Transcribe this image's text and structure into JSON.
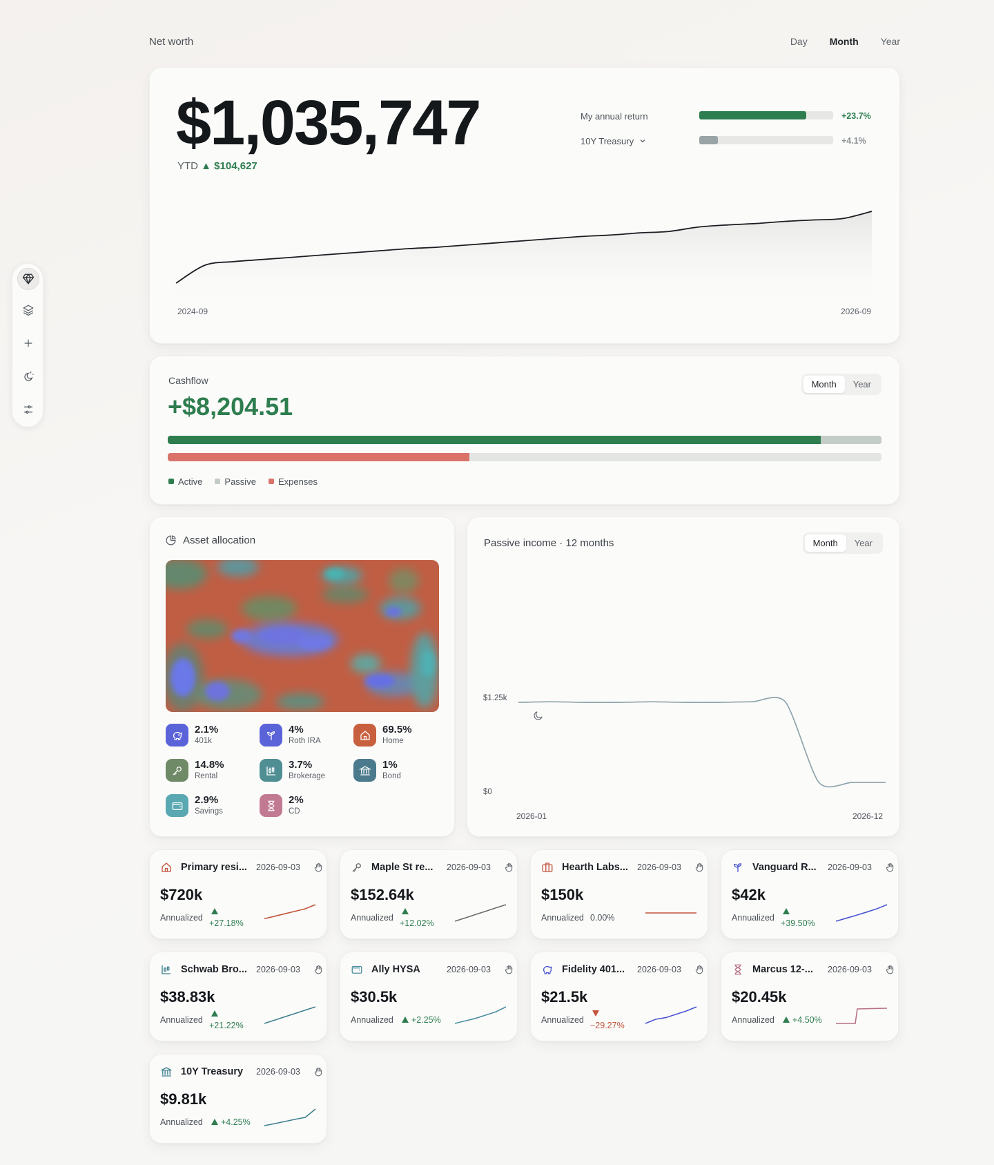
{
  "header": {
    "title": "Net worth",
    "periods": [
      "Day",
      "Month",
      "Year"
    ],
    "active_period": "Month"
  },
  "net_worth": {
    "value": "$1,035,747",
    "ytd_label": "YTD",
    "ytd_change": "▲ $104,627",
    "compare": [
      {
        "label": "My annual return",
        "value": "+23.7%",
        "fill": 0.8,
        "color": "#2e7d4f"
      },
      {
        "label": "10Y Treasury",
        "value": "+4.1%",
        "fill": 0.14,
        "color": "#9aa3a6",
        "dropdown": true
      }
    ],
    "x_start": "2024-09",
    "x_end": "2026-09"
  },
  "chart_data": [
    {
      "type": "area",
      "title": "",
      "x_range": [
        "2024-09",
        "2026-09"
      ],
      "x": [
        "2024-09",
        "2024-10",
        "2024-11",
        "2024-12",
        "2025-01",
        "2025-02",
        "2025-03",
        "2025-04",
        "2025-05",
        "2025-06",
        "2025-07",
        "2025-08",
        "2025-09",
        "2025-10",
        "2025-11",
        "2025-12",
        "2026-01",
        "2026-02",
        "2026-03",
        "2026-04",
        "2026-05",
        "2026-06",
        "2026-07",
        "2026-08",
        "2026-09"
      ],
      "values": [
        0.0,
        0.25,
        0.3,
        0.33,
        0.36,
        0.39,
        0.42,
        0.45,
        0.48,
        0.5,
        0.53,
        0.56,
        0.59,
        0.62,
        0.65,
        0.67,
        0.7,
        0.72,
        0.78,
        0.81,
        0.83,
        0.86,
        0.88,
        0.9,
        1.0
      ],
      "grid": false
    },
    {
      "type": "line",
      "title": "Passive income · 12 months",
      "x_range": [
        "2026-01",
        "2026-12"
      ],
      "x": [
        "2026-01",
        "2026-02",
        "2026-03",
        "2026-04",
        "2026-05",
        "2026-06",
        "2026-07",
        "2026-08",
        "2026-09",
        "2026-10",
        "2026-11",
        "2026-12"
      ],
      "values": [
        1250,
        1260,
        1250,
        1250,
        1260,
        1250,
        1250,
        1260,
        1255,
        0,
        0,
        0
      ],
      "y_ticks": [
        "$0",
        "$1.25k"
      ],
      "ylim": [
        0,
        1250
      ],
      "grid": false
    }
  ],
  "cashflow": {
    "label": "Cashflow",
    "amount": "+$8,204.51",
    "periods": [
      "Month",
      "Year"
    ],
    "active_period": "Month",
    "income_bar": {
      "active": 0.915,
      "passive": 0.085
    },
    "expense_bar": 0.423,
    "legend": [
      {
        "label": "Active",
        "color": "#2e7d4f"
      },
      {
        "label": "Passive",
        "color": "#c4ccc8"
      },
      {
        "label": "Expenses",
        "color": "#d9736a"
      }
    ]
  },
  "allocation": {
    "title": "Asset allocation",
    "items": [
      {
        "pct": "2.1%",
        "name": "401k",
        "color": "#5b63d9",
        "icon": "piggy-bank-icon"
      },
      {
        "pct": "4%",
        "name": "Roth IRA",
        "color": "#5b63d9",
        "icon": "sprout-icon"
      },
      {
        "pct": "69.5%",
        "name": "Home",
        "color": "#c8603f",
        "icon": "home-icon"
      },
      {
        "pct": "14.8%",
        "name": "Rental",
        "color": "#6f8a66",
        "icon": "key-icon"
      },
      {
        "pct": "3.7%",
        "name": "Brokerage",
        "color": "#4f8f93",
        "icon": "candlestick-icon"
      },
      {
        "pct": "1%",
        "name": "Bond",
        "color": "#4b7a8c",
        "icon": "bank-icon"
      },
      {
        "pct": "2.9%",
        "name": "Savings",
        "color": "#5aa8b1",
        "icon": "wallet-icon"
      },
      {
        "pct": "2%",
        "name": "CD",
        "color": "#c27a93",
        "icon": "hourglass-icon"
      }
    ]
  },
  "passive": {
    "title": "Passive income · 12 months",
    "periods": [
      "Month",
      "Year"
    ],
    "active_period": "Month",
    "y_top": "$1.25k",
    "y_bottom": "$0",
    "x_start": "2026-01",
    "x_end": "2026-12"
  },
  "accounts": [
    {
      "name": "Primary resi...",
      "date": "2026-09-03",
      "value": "$720k",
      "label": "Annualized",
      "ret": "+27.18%",
      "dir": "up",
      "stack": true,
      "color": "#c2543c",
      "icon": "home-icon",
      "spark": [
        0.15,
        0.3,
        0.45,
        0.6,
        0.75,
        1.0
      ]
    },
    {
      "name": "Maple St re...",
      "date": "2026-09-03",
      "value": "$152.64k",
      "label": "Annualized",
      "ret": "+12.02%",
      "dir": "up",
      "stack": true,
      "color": "#6b6b68",
      "icon": "key-icon",
      "spark": [
        0.0,
        0.2,
        0.4,
        0.6,
        0.8,
        1.0
      ]
    },
    {
      "name": "Hearth Labs...",
      "date": "2026-09-03",
      "value": "$150k",
      "label": "Annualized",
      "ret": "0.00%",
      "dir": "flat",
      "stack": false,
      "color": "#c2543c",
      "icon": "briefcase-icon",
      "spark": [
        0.5,
        0.5,
        0.5,
        0.5,
        0.5,
        0.5
      ]
    },
    {
      "name": "Vanguard R...",
      "date": "2026-09-03",
      "value": "$42k",
      "label": "Annualized",
      "ret": "+39.50%",
      "dir": "up",
      "stack": true,
      "color": "#4a55d0",
      "icon": "sprout-icon",
      "spark": [
        0.0,
        0.18,
        0.36,
        0.55,
        0.75,
        1.0
      ]
    },
    {
      "name": "Schwab Bro...",
      "date": "2026-09-03",
      "value": "$38.83k",
      "label": "Annualized",
      "ret": "+21.22%",
      "dir": "up",
      "stack": true,
      "color": "#3d7f8c",
      "icon": "candlestick-icon",
      "spark": [
        0.0,
        0.2,
        0.4,
        0.6,
        0.8,
        1.0
      ]
    },
    {
      "name": "Ally HYSA",
      "date": "2026-09-03",
      "value": "$30.5k",
      "label": "Annualized",
      "ret": "+2.25%",
      "dir": "up",
      "stack": false,
      "color": "#4c8fa3",
      "icon": "wallet-icon",
      "spark": [
        0.0,
        0.15,
        0.3,
        0.5,
        0.7,
        1.0
      ]
    },
    {
      "name": "Fidelity 401...",
      "date": "2026-09-03",
      "value": "$21.5k",
      "label": "Annualized",
      "ret": "−29.27%",
      "dir": "down",
      "stack": true,
      "color": "#4a55d0",
      "icon": "piggy-bank-icon",
      "spark": [
        0.0,
        0.25,
        0.35,
        0.55,
        0.75,
        1.0
      ]
    },
    {
      "name": "Marcus 12-...",
      "date": "2026-09-03",
      "value": "$20.45k",
      "label": "Annualized",
      "ret": "+4.50%",
      "dir": "up",
      "stack": false,
      "color": "#b87285",
      "icon": "hourglass-icon",
      "spark": [
        0.0,
        0.0,
        0.0,
        1.0,
        1.0,
        1.0
      ]
    },
    {
      "name": "10Y Treasury",
      "date": "2026-09-03",
      "value": "$9.81k",
      "label": "Annualized",
      "ret": "+4.25%",
      "dir": "up",
      "stack": false,
      "color": "#3d7f8c",
      "icon": "bank-icon",
      "spark": [
        0.0,
        0.12,
        0.25,
        0.38,
        0.5,
        1.0
      ]
    }
  ],
  "toolbar": {
    "items": [
      "gem-icon",
      "layers-icon",
      "plus-icon",
      "sun-moon-icon",
      "sliders-icon"
    ],
    "active": "gem-icon"
  }
}
